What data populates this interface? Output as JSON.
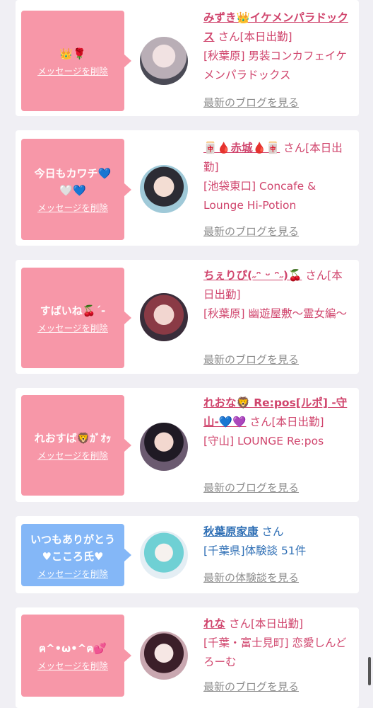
{
  "delete_label": "メッセージを削除",
  "cards": [
    {
      "message": "👑🌹",
      "name": "みずき👑イケメンパラドックス",
      "suffix": "さん[本日出勤]",
      "location": "[秋葉原] 男装コンカフェイケメンパラドックス",
      "link": "最新のブログを見る"
    },
    {
      "message": "今日もカワチ💙\n🤍💙",
      "name": "🀄🩸赤城🩸🀄",
      "suffix": "さん[本日出勤]",
      "location": "[池袋東口] Concafe & Lounge Hi-Potion",
      "link": "最新のブログを見る"
    },
    {
      "message": "すばいね🍒´-",
      "name": "ちぇりぴ(˶ᵔ ᵕ ᵔ˶)🍒",
      "suffix": "さん[本日出勤]",
      "location": "[秋葉原] 幽遊屋敷〜霊女編〜",
      "link": "最新のブログを見る"
    },
    {
      "message": "れおすば🦁ｶﾞｵｯ",
      "name": "れおな🦁 Re:pos[ルポ] -守山-💙💜",
      "suffix": "さん[本日出勤]",
      "location": "[守山] LOUNGE Re:pos",
      "link": "最新のブログを見る"
    },
    {
      "message": "いつもありがとう\n♥こころ氏♥",
      "name": "秋葉原家康",
      "suffix": "さん",
      "location": "[千葉県]体験談 51件",
      "link": "最新の体験談を見る"
    },
    {
      "message": "ฅ^•ω•^ฅ💕",
      "name": "れな",
      "suffix": "さん[本日出勤]",
      "location": "[千葉・富士見町] 恋愛しんどろーむ",
      "link": "最新のブログを見る"
    }
  ]
}
